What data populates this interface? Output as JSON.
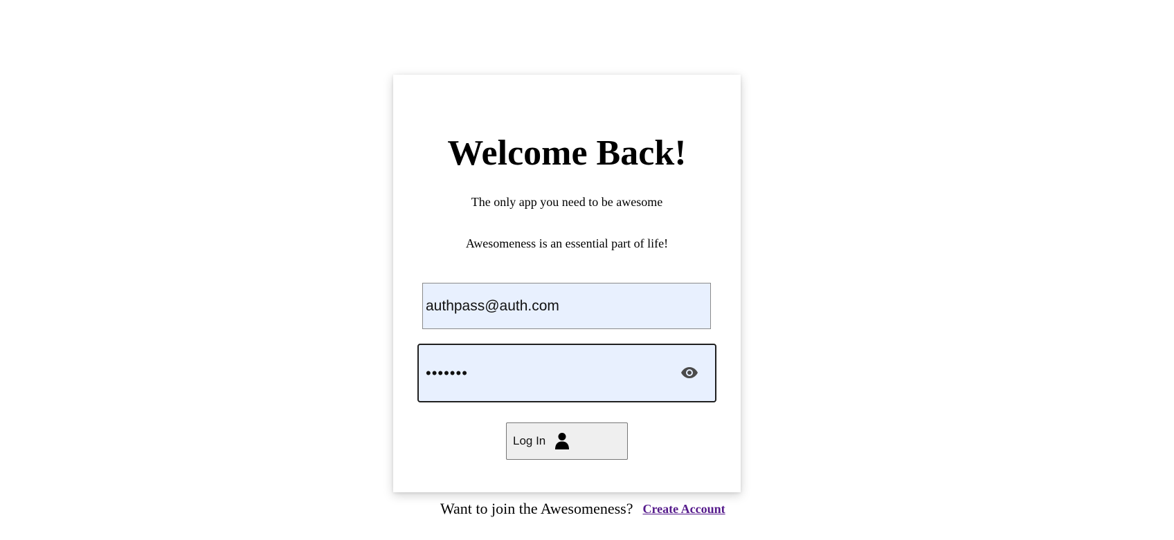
{
  "card": {
    "title": "Welcome Back!",
    "subtitle_1": "The only app you need to be awesome",
    "subtitle_2": "Awesomeness is an essential part of life!"
  },
  "form": {
    "email_value": "authpass@auth.com",
    "password_value": "•••••••",
    "password_toggle_icon": "eye-icon",
    "login_label": "Log In",
    "login_icon": "user-icon"
  },
  "footer": {
    "prompt": "Want to join the Awesomeness?",
    "link_label": "Create Account"
  },
  "colors": {
    "input_background": "#e8f0fe",
    "button_background": "#efefef",
    "link_visited": "#551a8b"
  }
}
